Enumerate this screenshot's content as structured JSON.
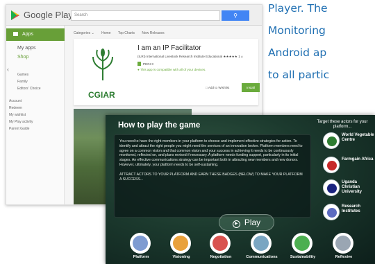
{
  "article": {
    "lines": [
      "Player. The",
      "Monitoring",
      "Android ap",
      "to all partic"
    ]
  },
  "google_play": {
    "brand": "Google Play",
    "search_placeholder": "Search",
    "sidebar": {
      "apps_label": "Apps",
      "items": [
        "My apps",
        "Shop"
      ],
      "categories": [
        "Games",
        "Family",
        "Editors' Choice"
      ],
      "account_links": [
        "Account",
        "Redeem",
        "My wishlist",
        "My Play activity",
        "Parent Guide"
      ]
    },
    "nav": [
      "Categories ⌄",
      "Home",
      "Top Charts",
      "New Releases"
    ],
    "app": {
      "title": "I am an IP Facilitator",
      "developer_line": "(ILRI) International Livestock Research Institute  Educational ★★★★★ 1 ±",
      "rating_label": "PEGI 3",
      "compat": "This app is compatible with all of your devices.",
      "wishlist": "Add to Wishlist",
      "install": "Install",
      "logo_text": "CGIAR"
    },
    "colors": {
      "accent": "#689f38",
      "search_button": "#4285f4"
    }
  },
  "game": {
    "title": "How to play the game",
    "body": "You need to have the right members in your platform to choose and implement effective strategies for action. To identify and attract the right people you might need the services of an innovation broker. Platform members need to agree on a common vision and that common vision and your success in achieving it needs to be continuously monitored, reflected on, and plans revised if necessary. A platform needs funding support, particularly in its initial stages. An effective communications strategy can be important both in attracting new members and new donors. However, ultimately, your platform needs to be self-sustaining.",
    "cta": "ATTRACT ACTORS TO YOUR PLATFORM AND EARN THESE BADGES (BELOW) TO MAKE YOUR PLATFORM A SUCCESS...",
    "play_label": "Play",
    "target_title": "Target these actors for your platform...",
    "actors": [
      {
        "label": "World Vegetable Centre",
        "color": "#2e7d32"
      },
      {
        "label": "Farmgain Africa",
        "color": "#c62828"
      },
      {
        "label": "Uganda Christian University",
        "color": "#1a237e"
      },
      {
        "label": "Research Institutes",
        "color": "#5c6bc0"
      }
    ],
    "badges": [
      {
        "label": "Platform",
        "color": "#7e9bd1"
      },
      {
        "label": "Visioning",
        "color": "#e9a13b"
      },
      {
        "label": "Negotiation",
        "color": "#d9534f"
      },
      {
        "label": "Communications",
        "color": "#7aa6c2"
      },
      {
        "label": "Sustainability",
        "color": "#4caf50"
      },
      {
        "label": "Reflexive",
        "color": "#9aa6b3"
      }
    ]
  }
}
